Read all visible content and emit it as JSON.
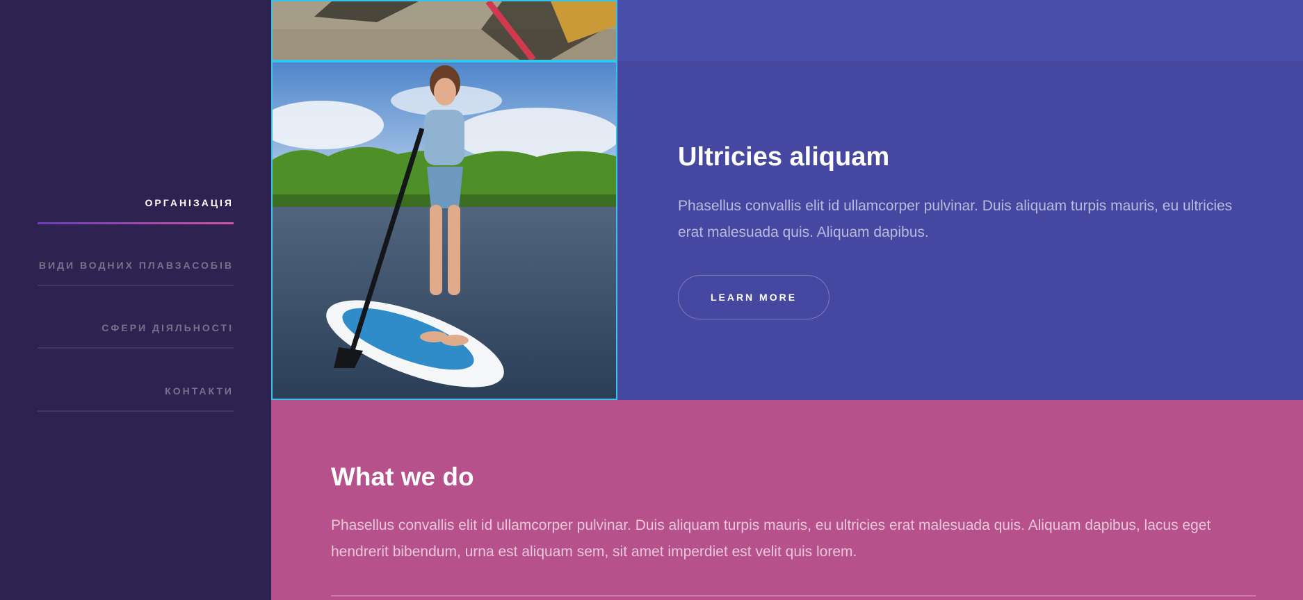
{
  "sidebar": {
    "items": [
      {
        "label": "ОРГАНІЗАЦІЯ",
        "active": true
      },
      {
        "label": "ВИДИ ВОДНИХ ПЛАВЗАСОБІВ",
        "active": false
      },
      {
        "label": "СФЕРИ ДІЯЛЬНОСТІ",
        "active": false
      },
      {
        "label": "КОНТАКТИ",
        "active": false
      }
    ]
  },
  "feature": {
    "title": "Ultricies aliquam",
    "text": "Phasellus convallis elit id ullamcorper pulvinar. Duis aliquam turpis mauris, eu ultricies erat malesuada quis. Aliquam dapibus.",
    "button_label": "LEARN MORE"
  },
  "what_we_do": {
    "title": "What we do",
    "text": "Phasellus convallis elit id ullamcorper pulvinar. Duis aliquam turpis mauris, eu ultricies erat malesuada quis. Aliquam dapibus, lacus eget hendrerit bibendum, urna est aliquam sem, sit amet imperdiet est velit quis lorem."
  },
  "colors": {
    "sidebar_bg": "#2e2350",
    "feature_bg": "#4647a0",
    "section_bg": "#b7518c",
    "image_border": "#35c5e8",
    "active_underline_start": "#6a3fb8",
    "active_underline_end": "#d055a3"
  }
}
